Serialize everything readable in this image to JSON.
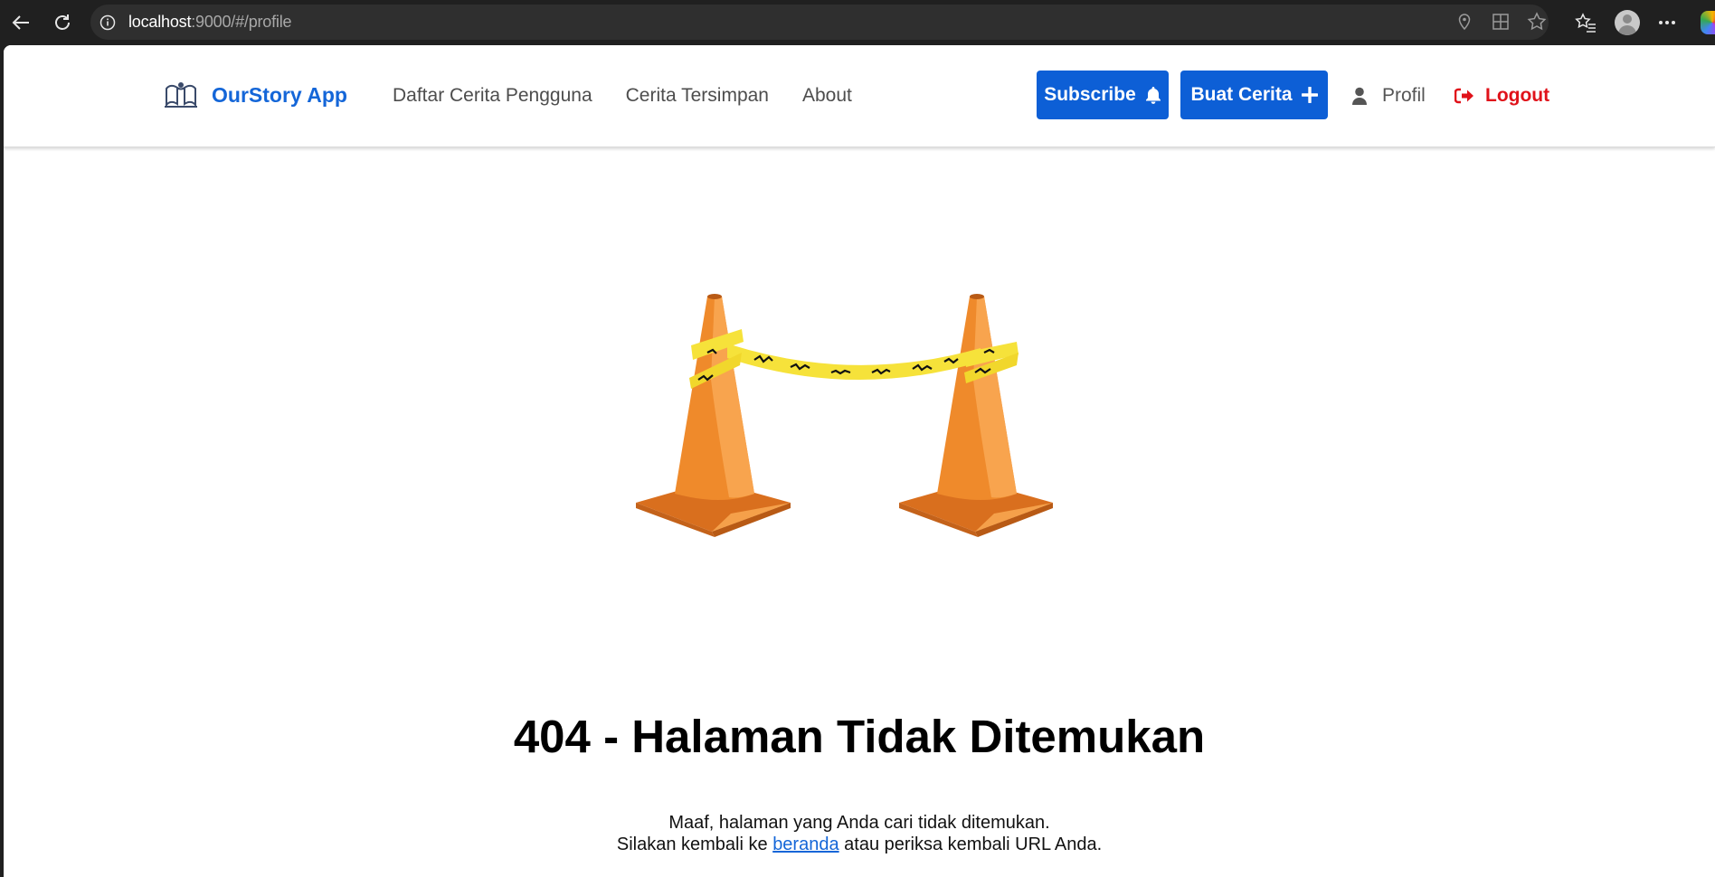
{
  "browser": {
    "url_host": "localhost",
    "url_path": ":9000/#/profile"
  },
  "header": {
    "brand": "OurStory App",
    "nav": [
      {
        "label": "Daftar Cerita Pengguna"
      },
      {
        "label": "Cerita Tersimpan"
      },
      {
        "label": "About"
      }
    ],
    "subscribe_label": "Subscribe",
    "create_label": "Buat Cerita",
    "profile_label": "Profil",
    "logout_label": "Logout"
  },
  "error": {
    "title": "404 - Halaman Tidak Ditemukan",
    "line1": "Maaf, halaman yang Anda cari tidak ditemukan.",
    "line2_before": "Silakan kembali ke ",
    "home_link": "beranda",
    "line2_after": " atau periksa kembali URL Anda."
  },
  "colors": {
    "primary": "#0d5fd6",
    "brand_text": "#1466d8",
    "logout": "#e0121a",
    "cone_orange": "#ef8a2b",
    "tape_yellow": "#f6e23a"
  },
  "icons": [
    "back-icon",
    "reload-icon",
    "info-icon",
    "location-icon",
    "apps-icon",
    "star-icon",
    "favorites-icon",
    "profile-avatar-icon",
    "more-icon",
    "bell-icon",
    "plus-icon",
    "user-icon",
    "logout-icon"
  ]
}
